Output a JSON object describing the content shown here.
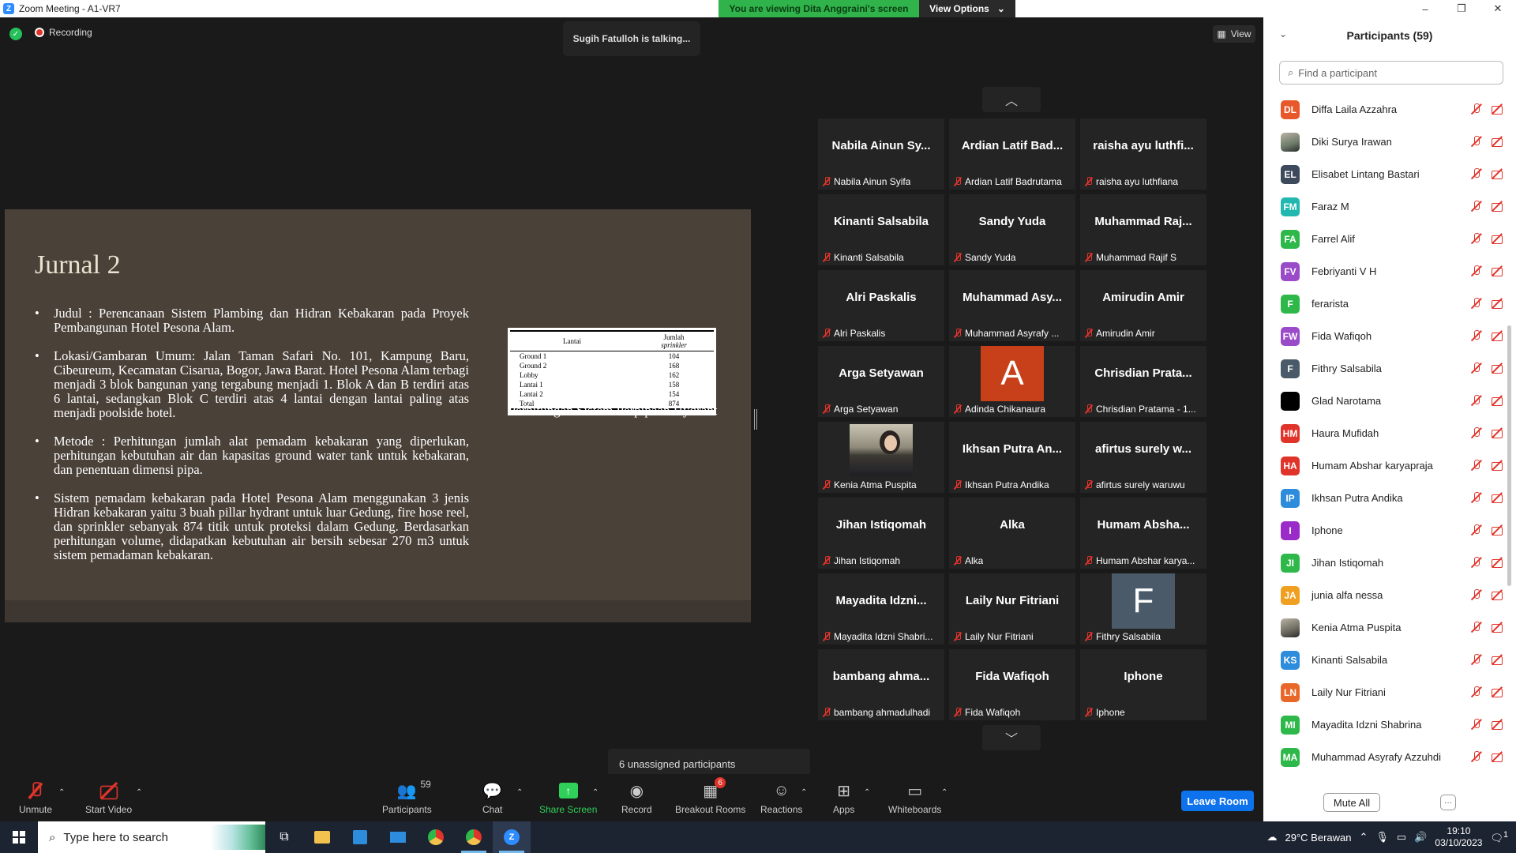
{
  "window": {
    "app_icon": "Z",
    "title": "Zoom Meeting - A1-VR7",
    "minimize": "–",
    "restore": "❐",
    "close": "✕"
  },
  "banner": {
    "viewing_text": "You are viewing Dita Anggraini's screen",
    "view_options_label": "View Options"
  },
  "top": {
    "recording_label": "Recording",
    "talking_text": "Sugih Fatulloh is talking...",
    "view_label": "View"
  },
  "slide": {
    "title": "Jurnal 2",
    "bullets": [
      "Judul : Perencanaan Sistem Plambing dan Hidran Kebakaran pada Proyek Pembangunan Hotel Pesona Alam.",
      "Lokasi/Gambaran Umum: Jalan Taman Safari No. 101, Kampung Baru, Cibeureum, Kecamatan Cisarua, Bogor, Jawa Barat. Hotel Pesona Alam terbagi menjadi 3 blok bangunan yang tergabung menjadi 1. Blok A dan B terdiri atas 6 lantai, sedangkan Blok C terdiri atas 4 lantai dengan lantai paling atas menjadi poolside hotel.",
      "Metode : Perhitungan jumlah alat pemadam kebakaran yang diperlukan, perhitungan kebutuhan air dan kapasitas ground water tank untuk kebakaran, dan penentuan dimensi pipa.",
      "Sistem pemadam kebakaran pada Hotel Pesona Alam menggunakan 3 jenis Hidran kebakaran yaitu 3 buah pillar hydrant untuk luar Gedung, fire hose reel, dan sprinkler sebanyak 874 titik untuk proteksi dalam Gedung. Berdasarkan perhitungan volume, didapatkan kebutuhan air bersih sebesar 270 m3 untuk sistem pemadaman kebakaran."
    ],
    "table": {
      "col1": "Lantai",
      "col2": "Jumlah",
      "col2_sub": "sprinkler",
      "rows": [
        {
          "floor": "Ground 1",
          "count": "104"
        },
        {
          "floor": "Ground 2",
          "count": "168"
        },
        {
          "floor": "Lobby",
          "count": "162"
        },
        {
          "floor": "Lantai 1",
          "count": "158"
        },
        {
          "floor": "Lantai 2",
          "count": "154"
        },
        {
          "floor": "Total",
          "count": "874"
        }
      ]
    },
    "caption": "Perhitungan Sistem Perpipaan Hydrant"
  },
  "gallery": {
    "tiles": [
      {
        "center": "Nabila Ainun Sy...",
        "name": "Nabila Ainun Syifa",
        "kind": "text"
      },
      {
        "center": "Ardian Latif Bad...",
        "name": "Ardian Latif Badrutama",
        "kind": "text"
      },
      {
        "center": "raisha ayu luthfi...",
        "name": "raisha ayu luthfiana",
        "kind": "text"
      },
      {
        "center": "Kinanti Salsabila",
        "name": "Kinanti Salsabila",
        "kind": "text"
      },
      {
        "center": "Sandy Yuda",
        "name": "Sandy Yuda",
        "kind": "text"
      },
      {
        "center": "Muhammad Raj...",
        "name": "Muhammad Rajif S",
        "kind": "text"
      },
      {
        "center": "Alri Paskalis",
        "name": "Alri Paskalis",
        "kind": "text"
      },
      {
        "center": "Muhammad Asy...",
        "name": "Muhammad Asyrafy ...",
        "kind": "text"
      },
      {
        "center": "Amirudin Amir",
        "name": "Amirudin Amir",
        "kind": "text"
      },
      {
        "center": "Arga Setyawan",
        "name": "Arga Setyawan",
        "kind": "text"
      },
      {
        "center": "A",
        "name": "Adinda Chikanaura",
        "kind": "letter",
        "color": "#c8401a"
      },
      {
        "center": "Chrisdian Prata...",
        "name": "Chrisdian Pratama - 1...",
        "kind": "text"
      },
      {
        "center": "",
        "name": "Kenia Atma Puspita",
        "kind": "photo"
      },
      {
        "center": "Ikhsan Putra An...",
        "name": "Ikhsan Putra Andika",
        "kind": "text"
      },
      {
        "center": "afirtus surely w...",
        "name": "afirtus surely waruwu",
        "kind": "text"
      },
      {
        "center": "Jihan Istiqomah",
        "name": "Jihan Istiqomah",
        "kind": "text"
      },
      {
        "center": "Alka",
        "name": "Alka",
        "kind": "text"
      },
      {
        "center": "Humam Absha...",
        "name": "Humam Abshar karya...",
        "kind": "text"
      },
      {
        "center": "Mayadita Idzni...",
        "name": "Mayadita Idzni Shabri...",
        "kind": "text"
      },
      {
        "center": "Laily Nur Fitriani",
        "name": "Laily Nur Fitriani",
        "kind": "text"
      },
      {
        "center": "F",
        "name": "Fithry Salsabila",
        "kind": "letter",
        "color": "#4b5a68"
      },
      {
        "center": "bambang ahma...",
        "name": "bambang ahmadulhadi",
        "kind": "text"
      },
      {
        "center": "Fida Wafiqoh",
        "name": "Fida Wafiqoh",
        "kind": "text"
      },
      {
        "center": "Iphone",
        "name": "Iphone",
        "kind": "text"
      }
    ]
  },
  "unassigned_text": "6 unassigned participants",
  "toolbar": {
    "unmute": "Unmute",
    "start_video": "Start Video",
    "participants": "Participants",
    "participants_count": "59",
    "chat": "Chat",
    "share_screen": "Share Screen",
    "record": "Record",
    "breakout_rooms": "Breakout Rooms",
    "breakout_badge": "6",
    "reactions": "Reactions",
    "apps": "Apps",
    "whiteboards": "Whiteboards",
    "leave_room": "Leave Room"
  },
  "panel": {
    "title": "Participants (59)",
    "search_placeholder": "Find a participant",
    "participants": [
      {
        "initials": "DL",
        "name": "Diffa Laila Azzahra",
        "color": "#e8582a"
      },
      {
        "initials": "",
        "name": "Diki Surya Irawan",
        "color": "#6c7a6a",
        "photo": true
      },
      {
        "initials": "EL",
        "name": "Elisabet Lintang Bastari",
        "color": "#3d4a5c"
      },
      {
        "initials": "FM",
        "name": "Faraz M",
        "color": "#22b8b0"
      },
      {
        "initials": "FA",
        "name": "Farrel Alif",
        "color": "#2fb84a"
      },
      {
        "initials": "FV",
        "name": "Febriyanti V H",
        "color": "#9a4bc8"
      },
      {
        "initials": "F",
        "name": "feraristа",
        "color": "#2fb84a"
      },
      {
        "initials": "FW",
        "name": "Fida Wafiqoh",
        "color": "#9a4bc8"
      },
      {
        "initials": "F",
        "name": "Fithry Salsabila",
        "color": "#4b5a68"
      },
      {
        "initials": "",
        "name": "Glad Narotama",
        "color": "#000000"
      },
      {
        "initials": "HM",
        "name": "Haura Mufidah",
        "color": "#e0342b"
      },
      {
        "initials": "HA",
        "name": "Humam Abshar karyapraja",
        "color": "#e0342b"
      },
      {
        "initials": "IP",
        "name": "Ikhsan Putra Andika",
        "color": "#2d8cdb"
      },
      {
        "initials": "I",
        "name": "Iphone",
        "color": "#9a2bc8"
      },
      {
        "initials": "JI",
        "name": "Jihan Istiqomah",
        "color": "#2fb84a"
      },
      {
        "initials": "JA",
        "name": "junia alfa nessa",
        "color": "#f0a020"
      },
      {
        "initials": "",
        "name": "Kenia Atma Puspita",
        "color": "#6c6a60",
        "photo": true
      },
      {
        "initials": "KS",
        "name": "Kinanti Salsabila",
        "color": "#2d8cdb"
      },
      {
        "initials": "LN",
        "name": "Laily Nur Fitriani",
        "color": "#e8682a"
      },
      {
        "initials": "MI",
        "name": "Mayadita Idzni Shabrina",
        "color": "#2fb84a"
      },
      {
        "initials": "MA",
        "name": "Muhammad Asyrafy Azzuhdi",
        "color": "#2fb84a"
      },
      {
        "initials": "",
        "name": "",
        "color": "#22b8b0"
      }
    ],
    "mute_all": "Mute All",
    "more": "···"
  },
  "taskbar": {
    "search_placeholder": "Type here to search",
    "weather": "29°C  Berawan",
    "time": "19:10",
    "date": "03/10/2023",
    "notif_count": "1"
  }
}
